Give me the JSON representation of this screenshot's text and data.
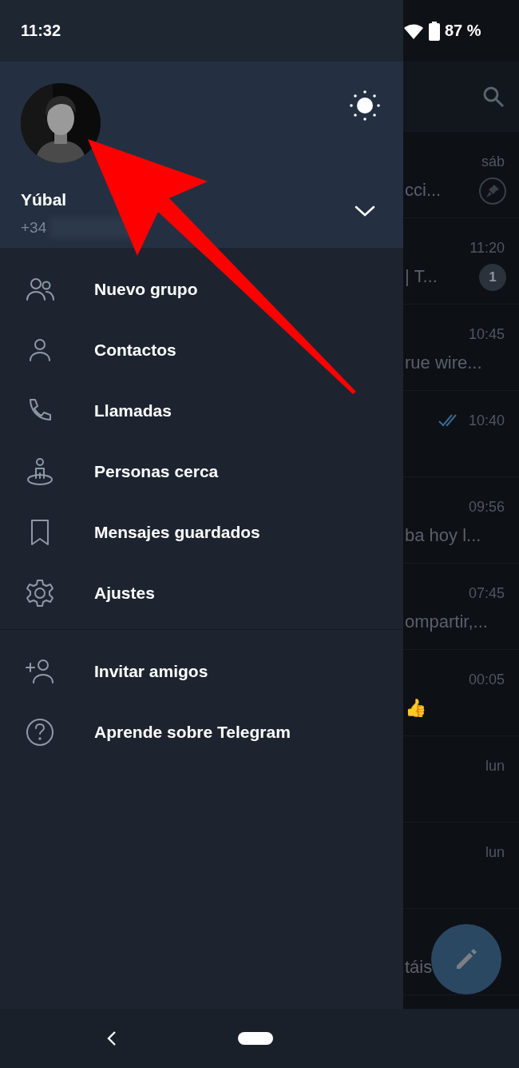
{
  "status_bar": {
    "time": "11:32",
    "battery": "87 %"
  },
  "drawer": {
    "account": {
      "name": "Yúbal",
      "phone": "+34",
      "expanded": false
    },
    "menu": [
      {
        "label": "Nuevo grupo",
        "kind": "group"
      },
      {
        "label": "Contactos",
        "kind": "person"
      },
      {
        "label": "Llamadas",
        "kind": "phone"
      },
      {
        "label": "Personas cerca",
        "kind": "nearby"
      },
      {
        "label": "Mensajes guardados",
        "kind": "bookmark"
      },
      {
        "label": "Ajustes",
        "kind": "settings"
      }
    ],
    "secondary_menu": [
      {
        "label": "Invitar amigos",
        "kind": "invite"
      },
      {
        "label": "Aprende sobre Telegram",
        "kind": "help"
      }
    ]
  },
  "chats": [
    {
      "time": "sáb",
      "preview": "cci...",
      "pinned": true,
      "read": false
    },
    {
      "time": "11:20",
      "preview": "| T...",
      "badge": "1",
      "pinned": false,
      "read": false
    },
    {
      "time": "10:45",
      "preview": "rue wire...",
      "pinned": false,
      "read": false
    },
    {
      "time": "10:40",
      "pinned": false,
      "read": true
    },
    {
      "time": "09:56",
      "preview": "ba hoy l...",
      "pinned": false,
      "read": false
    },
    {
      "time": "07:45",
      "preview": "ompartir,...",
      "pinned": false,
      "read": false
    },
    {
      "time": "00:05",
      "preview": "👍",
      "pinned": false,
      "read": false
    },
    {
      "time": "lun",
      "pinned": false,
      "read": false
    },
    {
      "time": "lun",
      "pinned": false,
      "read": false
    },
    {
      "preview": "táis",
      "pinned": false,
      "read": false
    }
  ]
}
